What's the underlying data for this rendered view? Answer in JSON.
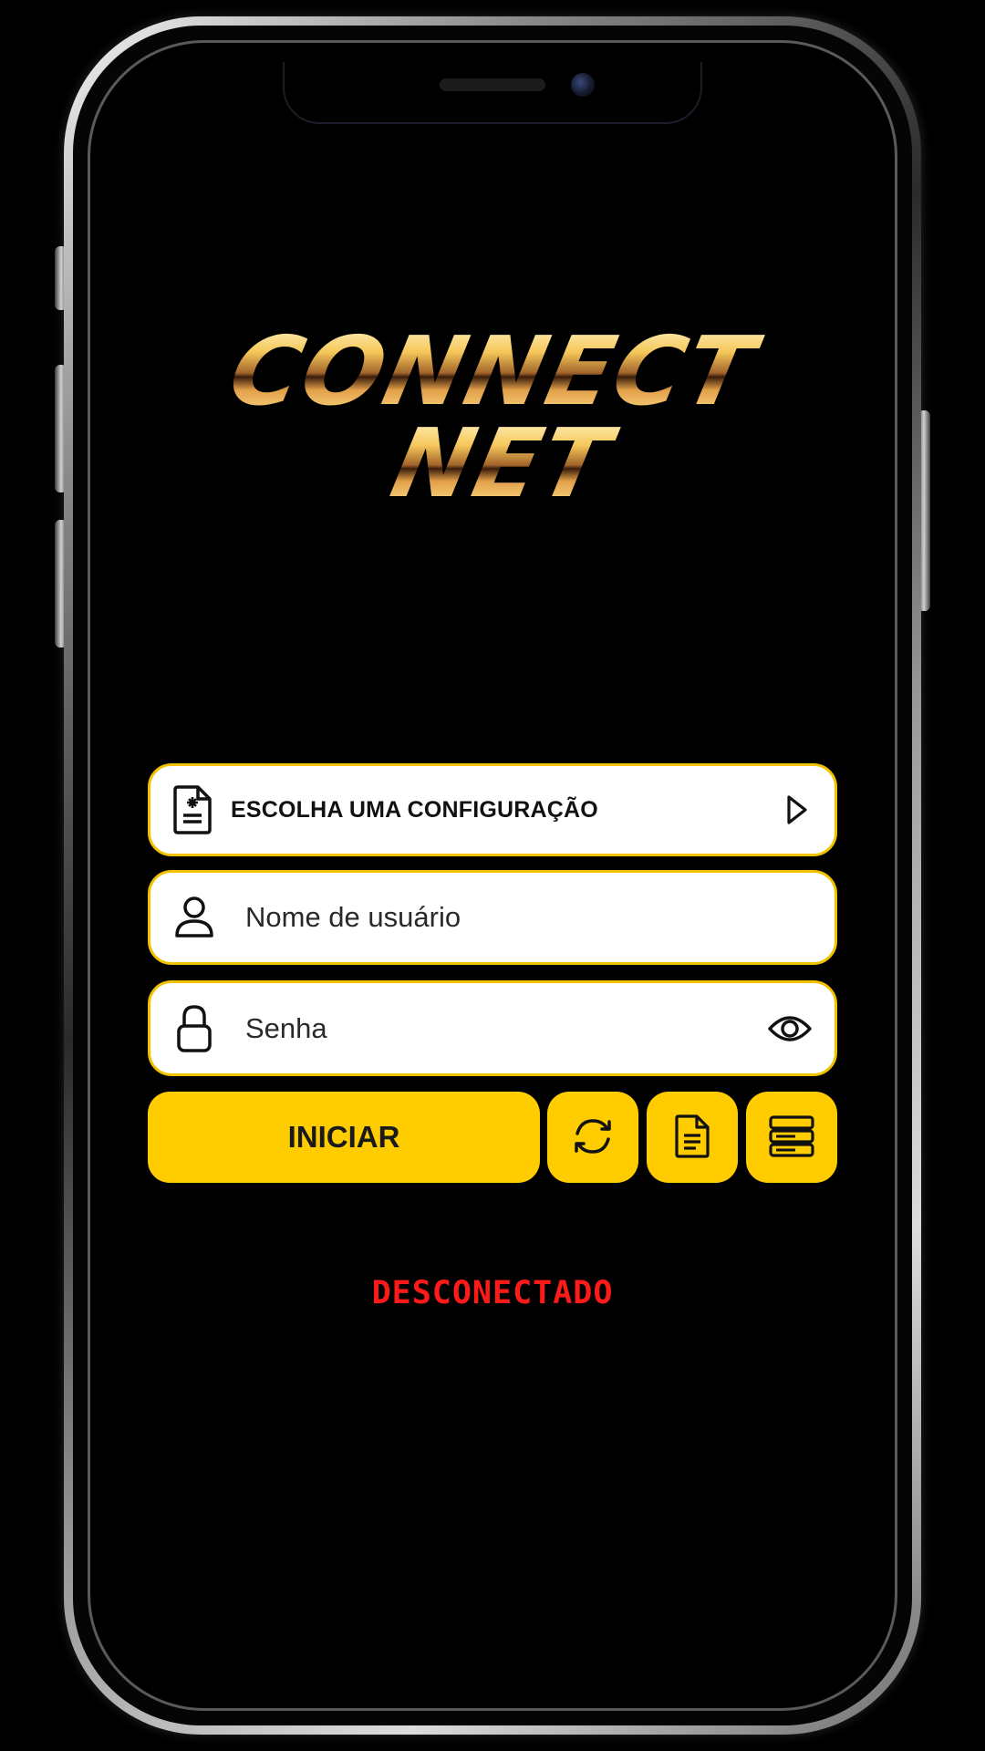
{
  "logo": {
    "line1": "CONNECT",
    "line2": "NET"
  },
  "config_selector": {
    "label": "ESCOLHA UMA CONFIGURAÇÃO",
    "icon": "config-file-icon",
    "action_icon": "play-arrow-icon"
  },
  "username": {
    "placeholder": "Nome de usuário",
    "value": "",
    "icon": "user-icon"
  },
  "password": {
    "placeholder": "Senha",
    "value": "",
    "icon": "lock-icon",
    "toggle_icon": "eye-icon"
  },
  "actions": {
    "start_label": "INICIAR",
    "buttons": [
      "refresh-icon",
      "document-icon",
      "server-icon"
    ]
  },
  "status": {
    "text": "DESCONECTADO",
    "color": "#ff1a1a"
  },
  "colors": {
    "accent": "#ffcc00",
    "background": "#000000",
    "field_bg": "#ffffff"
  }
}
